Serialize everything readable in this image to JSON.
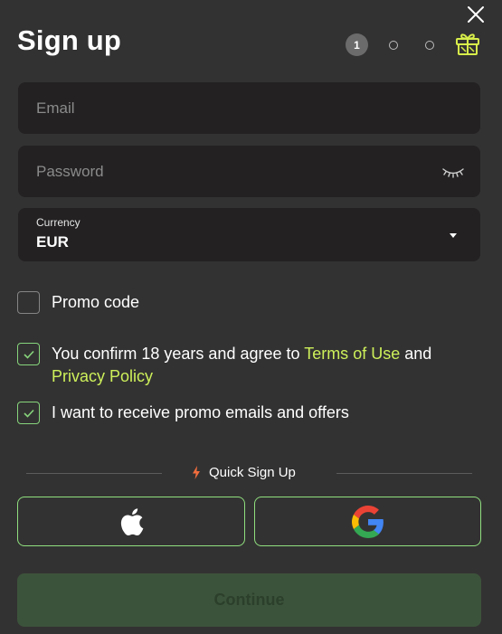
{
  "header": {
    "title": "Sign up",
    "steps": [
      "1",
      "",
      ""
    ],
    "icons": {
      "close": "close-icon",
      "gift": "gift-icon"
    }
  },
  "form": {
    "email": {
      "placeholder": "Email",
      "value": ""
    },
    "password": {
      "placeholder": "Password",
      "value": "",
      "toggle_icon": "eye-closed-icon"
    },
    "currency": {
      "label": "Currency",
      "value": "EUR"
    }
  },
  "checkboxes": {
    "promo_code": {
      "label": "Promo code",
      "checked": false
    },
    "terms": {
      "prefix": "You confirm 18 years and agree to ",
      "terms_link": "Terms of Use",
      "middle": " and",
      "privacy_link": "Privacy Policy",
      "checked": true
    },
    "emails": {
      "label": "I want to receive promo emails and offers",
      "checked": true
    }
  },
  "quick_signup": {
    "label": "Quick Sign Up",
    "icon": "lightning-icon",
    "providers": [
      "apple-icon",
      "google-icon"
    ]
  },
  "continue_label": "Continue",
  "colors": {
    "background": "#333232",
    "field": "#232121",
    "accent_link": "#cdf05a",
    "check_border": "#86d57c",
    "continue_bg": "#3c533b"
  }
}
